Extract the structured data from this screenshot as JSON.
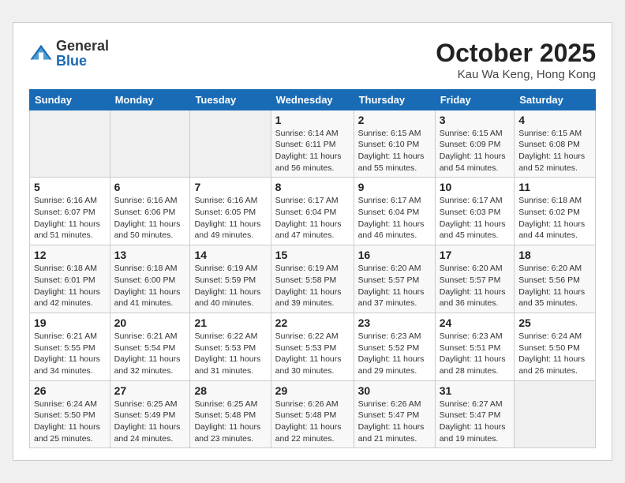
{
  "header": {
    "logo_line1": "General",
    "logo_line2": "Blue",
    "month_title": "October 2025",
    "subtitle": "Kau Wa Keng, Hong Kong"
  },
  "weekdays": [
    "Sunday",
    "Monday",
    "Tuesday",
    "Wednesday",
    "Thursday",
    "Friday",
    "Saturday"
  ],
  "weeks": [
    [
      {
        "day": "",
        "info": ""
      },
      {
        "day": "",
        "info": ""
      },
      {
        "day": "",
        "info": ""
      },
      {
        "day": "1",
        "info": "Sunrise: 6:14 AM\nSunset: 6:11 PM\nDaylight: 11 hours\nand 56 minutes."
      },
      {
        "day": "2",
        "info": "Sunrise: 6:15 AM\nSunset: 6:10 PM\nDaylight: 11 hours\nand 55 minutes."
      },
      {
        "day": "3",
        "info": "Sunrise: 6:15 AM\nSunset: 6:09 PM\nDaylight: 11 hours\nand 54 minutes."
      },
      {
        "day": "4",
        "info": "Sunrise: 6:15 AM\nSunset: 6:08 PM\nDaylight: 11 hours\nand 52 minutes."
      }
    ],
    [
      {
        "day": "5",
        "info": "Sunrise: 6:16 AM\nSunset: 6:07 PM\nDaylight: 11 hours\nand 51 minutes."
      },
      {
        "day": "6",
        "info": "Sunrise: 6:16 AM\nSunset: 6:06 PM\nDaylight: 11 hours\nand 50 minutes."
      },
      {
        "day": "7",
        "info": "Sunrise: 6:16 AM\nSunset: 6:05 PM\nDaylight: 11 hours\nand 49 minutes."
      },
      {
        "day": "8",
        "info": "Sunrise: 6:17 AM\nSunset: 6:04 PM\nDaylight: 11 hours\nand 47 minutes."
      },
      {
        "day": "9",
        "info": "Sunrise: 6:17 AM\nSunset: 6:04 PM\nDaylight: 11 hours\nand 46 minutes."
      },
      {
        "day": "10",
        "info": "Sunrise: 6:17 AM\nSunset: 6:03 PM\nDaylight: 11 hours\nand 45 minutes."
      },
      {
        "day": "11",
        "info": "Sunrise: 6:18 AM\nSunset: 6:02 PM\nDaylight: 11 hours\nand 44 minutes."
      }
    ],
    [
      {
        "day": "12",
        "info": "Sunrise: 6:18 AM\nSunset: 6:01 PM\nDaylight: 11 hours\nand 42 minutes."
      },
      {
        "day": "13",
        "info": "Sunrise: 6:18 AM\nSunset: 6:00 PM\nDaylight: 11 hours\nand 41 minutes."
      },
      {
        "day": "14",
        "info": "Sunrise: 6:19 AM\nSunset: 5:59 PM\nDaylight: 11 hours\nand 40 minutes."
      },
      {
        "day": "15",
        "info": "Sunrise: 6:19 AM\nSunset: 5:58 PM\nDaylight: 11 hours\nand 39 minutes."
      },
      {
        "day": "16",
        "info": "Sunrise: 6:20 AM\nSunset: 5:57 PM\nDaylight: 11 hours\nand 37 minutes."
      },
      {
        "day": "17",
        "info": "Sunrise: 6:20 AM\nSunset: 5:57 PM\nDaylight: 11 hours\nand 36 minutes."
      },
      {
        "day": "18",
        "info": "Sunrise: 6:20 AM\nSunset: 5:56 PM\nDaylight: 11 hours\nand 35 minutes."
      }
    ],
    [
      {
        "day": "19",
        "info": "Sunrise: 6:21 AM\nSunset: 5:55 PM\nDaylight: 11 hours\nand 34 minutes."
      },
      {
        "day": "20",
        "info": "Sunrise: 6:21 AM\nSunset: 5:54 PM\nDaylight: 11 hours\nand 32 minutes."
      },
      {
        "day": "21",
        "info": "Sunrise: 6:22 AM\nSunset: 5:53 PM\nDaylight: 11 hours\nand 31 minutes."
      },
      {
        "day": "22",
        "info": "Sunrise: 6:22 AM\nSunset: 5:53 PM\nDaylight: 11 hours\nand 30 minutes."
      },
      {
        "day": "23",
        "info": "Sunrise: 6:23 AM\nSunset: 5:52 PM\nDaylight: 11 hours\nand 29 minutes."
      },
      {
        "day": "24",
        "info": "Sunrise: 6:23 AM\nSunset: 5:51 PM\nDaylight: 11 hours\nand 28 minutes."
      },
      {
        "day": "25",
        "info": "Sunrise: 6:24 AM\nSunset: 5:50 PM\nDaylight: 11 hours\nand 26 minutes."
      }
    ],
    [
      {
        "day": "26",
        "info": "Sunrise: 6:24 AM\nSunset: 5:50 PM\nDaylight: 11 hours\nand 25 minutes."
      },
      {
        "day": "27",
        "info": "Sunrise: 6:25 AM\nSunset: 5:49 PM\nDaylight: 11 hours\nand 24 minutes."
      },
      {
        "day": "28",
        "info": "Sunrise: 6:25 AM\nSunset: 5:48 PM\nDaylight: 11 hours\nand 23 minutes."
      },
      {
        "day": "29",
        "info": "Sunrise: 6:26 AM\nSunset: 5:48 PM\nDaylight: 11 hours\nand 22 minutes."
      },
      {
        "day": "30",
        "info": "Sunrise: 6:26 AM\nSunset: 5:47 PM\nDaylight: 11 hours\nand 21 minutes."
      },
      {
        "day": "31",
        "info": "Sunrise: 6:27 AM\nSunset: 5:47 PM\nDaylight: 11 hours\nand 19 minutes."
      },
      {
        "day": "",
        "info": ""
      }
    ]
  ]
}
